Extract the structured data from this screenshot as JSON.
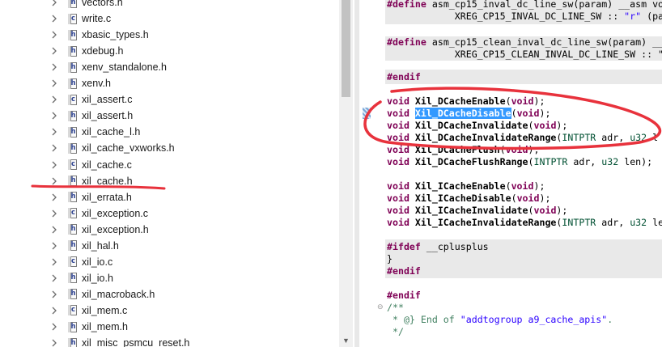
{
  "tree": {
    "files": [
      {
        "name": "vectors.h",
        "type": "h"
      },
      {
        "name": "write.c",
        "type": "c"
      },
      {
        "name": "xbasic_types.h",
        "type": "h"
      },
      {
        "name": "xdebug.h",
        "type": "h"
      },
      {
        "name": "xenv_standalone.h",
        "type": "h"
      },
      {
        "name": "xenv.h",
        "type": "h"
      },
      {
        "name": "xil_assert.c",
        "type": "c"
      },
      {
        "name": "xil_assert.h",
        "type": "h"
      },
      {
        "name": "xil_cache_l.h",
        "type": "h"
      },
      {
        "name": "xil_cache_vxworks.h",
        "type": "h"
      },
      {
        "name": "xil_cache.c",
        "type": "c"
      },
      {
        "name": "xil_cache.h",
        "type": "h"
      },
      {
        "name": "xil_errata.h",
        "type": "h"
      },
      {
        "name": "xil_exception.c",
        "type": "c"
      },
      {
        "name": "xil_exception.h",
        "type": "h"
      },
      {
        "name": "xil_hal.h",
        "type": "h"
      },
      {
        "name": "xil_io.c",
        "type": "c"
      },
      {
        "name": "xil_io.h",
        "type": "h"
      },
      {
        "name": "xil_macroback.h",
        "type": "h"
      },
      {
        "name": "xil_mem.c",
        "type": "c"
      },
      {
        "name": "xil_mem.h",
        "type": "h"
      },
      {
        "name": "xil_misc_psmcu_reset.h",
        "type": "h"
      }
    ],
    "icon_letters": {
      "h": "h",
      "c": "c"
    }
  },
  "editor": {
    "lines": {
      "l0a": "#define",
      "l0b": " asm_cp15_inval_dc_line_sw(param) __asm vo",
      "l1a": "            XREG_CP15_INVAL_DC_LINE_SW :: ",
      "l1s": "\"r\"",
      "l1b": " (pa",
      "l3a": "#define",
      "l3b": " asm_cp15_clean_inval_dc_line_sw(param) __",
      "l4": "            XREG_CP15_CLEAN_INVAL_DC_LINE_SW :: \"",
      "endif1": "#endif",
      "enable": "Xil_DCacheEnable",
      "disable": "Xil_DCacheDisable",
      "invalidate": "Xil_DCacheInvalidate",
      "invrange": "Xil_DCacheInvalidateRange",
      "flush": "Xil_DCacheFlush",
      "flushrange": "Xil_DCacheFlushRange",
      "ienable": "Xil_ICacheEnable",
      "idisable": "Xil_ICacheDisable",
      "iinvalidate": "Xil_ICacheInvalidate",
      "iinvrange": "Xil_ICacheInvalidateRange",
      "void_kw": "void",
      "paren_void_open": "(",
      "paren_void_close": ");",
      "range_args_a": "(",
      "range_type": "INTPTR",
      "range_args_b": " adr, ",
      "range_u32": "u32",
      "range_tail_cut": " l",
      "range_tail_cut2": " le",
      "flushrange_tail": " len);",
      "ifdef": "#ifdef",
      "cplusplus": " __cplusplus",
      "brace": "}",
      "endif2": "#endif",
      "endif3": "#endif",
      "cm_open": "/**",
      "cm_mid_a": " * @} End of ",
      "cm_mid_b": "\"addtogroup a9_cache_apis\"",
      "cm_mid_c": ".",
      "cm_close": " */"
    }
  },
  "colors": {
    "keyword": "#7f0055",
    "string": "#2a00ff",
    "type": "#005032",
    "comment": "#3f7f5f",
    "selection": "#3399ff",
    "annotation": "#e8323c"
  }
}
